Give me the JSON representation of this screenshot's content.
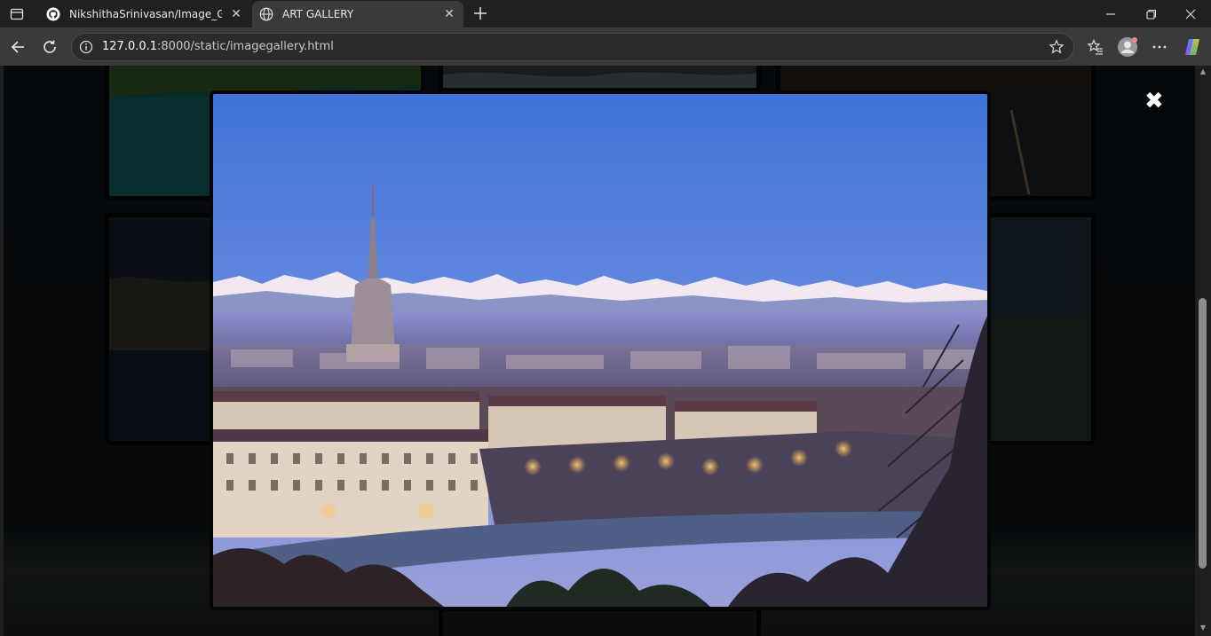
{
  "browser": {
    "tabs": [
      {
        "title": "NikshithaSrinivasan/Image_Gallery",
        "favicon": "github-icon",
        "active": false
      },
      {
        "title": "ART GALLERY",
        "favicon": "globe-icon",
        "active": true
      }
    ],
    "close_glyph": "✕",
    "address": {
      "host": "127.0.0.1",
      "path": ":8000/static/imagegallery.html"
    }
  },
  "page": {
    "lightbox": {
      "close_glyph": "✖",
      "image": "Turin city skyline at dusk with the Mole Antonelliana and snow-capped Alps"
    }
  },
  "scrollbar": {
    "up": "▲",
    "down": "▼"
  },
  "colors": {
    "tab_strip": "#202020",
    "active_tab": "#3a3a3a",
    "page_background": "#0b1013",
    "sky": "#4f7fd6"
  }
}
